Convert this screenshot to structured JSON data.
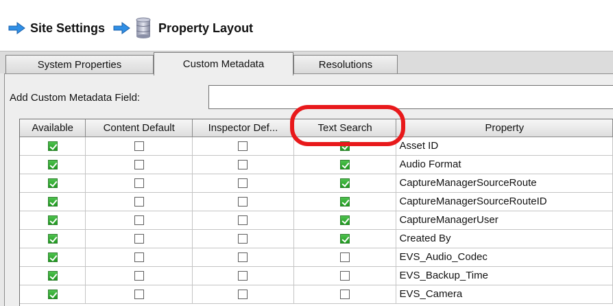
{
  "breadcrumb": {
    "items": [
      {
        "label": "Site Settings",
        "icon": "arrow-right-icon"
      },
      {
        "label": "Property Layout",
        "icon": "database-icon"
      }
    ],
    "separator_icon": "arrow-right-icon"
  },
  "tabs": [
    {
      "label": "System Properties",
      "active": false
    },
    {
      "label": "Custom Metadata",
      "active": true
    },
    {
      "label": "Resolutions",
      "active": false
    }
  ],
  "custom_field": {
    "label": "Add Custom Metadata Field:",
    "value": "",
    "placeholder": ""
  },
  "table": {
    "columns": [
      "Available",
      "Content Default",
      "Inspector Def...",
      "Text Search",
      "Property"
    ],
    "rows": [
      {
        "available": true,
        "content_default": false,
        "inspector_default": false,
        "text_search": true,
        "property": "Asset ID"
      },
      {
        "available": true,
        "content_default": false,
        "inspector_default": false,
        "text_search": true,
        "property": "Audio Format"
      },
      {
        "available": true,
        "content_default": false,
        "inspector_default": false,
        "text_search": true,
        "property": "CaptureManagerSourceRoute"
      },
      {
        "available": true,
        "content_default": false,
        "inspector_default": false,
        "text_search": true,
        "property": "CaptureManagerSourceRouteID"
      },
      {
        "available": true,
        "content_default": false,
        "inspector_default": false,
        "text_search": true,
        "property": "CaptureManagerUser"
      },
      {
        "available": true,
        "content_default": false,
        "inspector_default": false,
        "text_search": true,
        "property": "Created By"
      },
      {
        "available": true,
        "content_default": false,
        "inspector_default": false,
        "text_search": false,
        "property": "EVS_Audio_Codec"
      },
      {
        "available": true,
        "content_default": false,
        "inspector_default": false,
        "text_search": false,
        "property": "EVS_Backup_Time"
      },
      {
        "available": true,
        "content_default": false,
        "inspector_default": false,
        "text_search": false,
        "property": "EVS_Camera"
      }
    ]
  },
  "colors": {
    "accent_arrow": "#2f8fe6",
    "check_on": "#1f9a1f",
    "highlight": "#e8191b"
  }
}
